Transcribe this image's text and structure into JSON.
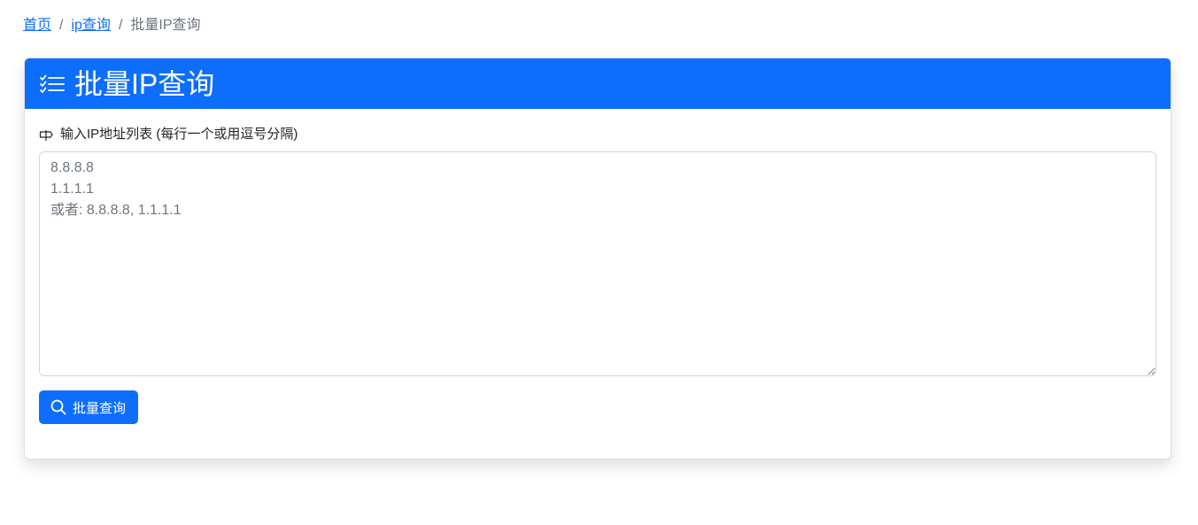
{
  "breadcrumb": {
    "home": "首页",
    "separator": "/",
    "ip_query": "ip查询",
    "current": "批量IP查询"
  },
  "card": {
    "header_icon": "list-check-icon",
    "title": "批量IP查询"
  },
  "form": {
    "label_icon": "signpost-icon",
    "label": "输入IP地址列表 (每行一个或用逗号分隔)",
    "textarea_value": "",
    "textarea_placeholder": "8.8.8.8\n1.1.1.1\n或者: 8.8.8.8, 1.1.1.1"
  },
  "button": {
    "icon": "search-icon",
    "label": "批量查询"
  },
  "colors": {
    "primary": "#0d6efd",
    "link": "#0d6efd",
    "muted": "#6c757d"
  }
}
